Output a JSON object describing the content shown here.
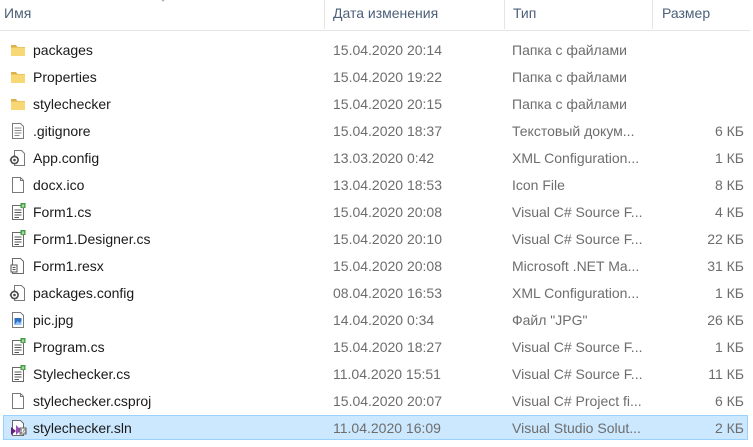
{
  "columns": {
    "name": "Имя",
    "date": "Дата изменения",
    "type": "Тип",
    "size": "Размер"
  },
  "files": [
    {
      "name": "packages",
      "date": "15.04.2020 20:14",
      "type": "Папка с файлами",
      "size": "",
      "icon": "folder-icon"
    },
    {
      "name": "Properties",
      "date": "15.04.2020 19:22",
      "type": "Папка с файлами",
      "size": "",
      "icon": "folder-icon"
    },
    {
      "name": "stylechecker",
      "date": "15.04.2020 20:15",
      "type": "Папка с файлами",
      "size": "",
      "icon": "folder-icon"
    },
    {
      "name": ".gitignore",
      "date": "15.04.2020 18:37",
      "type": "Текстовый докум...",
      "size": "6 КБ",
      "icon": "text-file-icon"
    },
    {
      "name": "App.config",
      "date": "13.03.2020 0:42",
      "type": "XML Configuration...",
      "size": "1 КБ",
      "icon": "config-file-icon"
    },
    {
      "name": "docx.ico",
      "date": "13.04.2020 18:53",
      "type": "Icon File",
      "size": "8 КБ",
      "icon": "blank-file-icon"
    },
    {
      "name": "Form1.cs",
      "date": "15.04.2020 20:08",
      "type": "Visual C# Source F...",
      "size": "4 КБ",
      "icon": "csharp-file-icon"
    },
    {
      "name": "Form1.Designer.cs",
      "date": "15.04.2020 20:10",
      "type": "Visual C# Source F...",
      "size": "22 КБ",
      "icon": "csharp-file-icon"
    },
    {
      "name": "Form1.resx",
      "date": "15.04.2020 20:08",
      "type": "Microsoft .NET Ma...",
      "size": "31 КБ",
      "icon": "resx-file-icon"
    },
    {
      "name": "packages.config",
      "date": "08.04.2020 16:53",
      "type": "XML Configuration...",
      "size": "1 КБ",
      "icon": "config-file-icon"
    },
    {
      "name": "pic.jpg",
      "date": "14.04.2020 0:34",
      "type": "Файл \"JPG\"",
      "size": "26 КБ",
      "icon": "image-file-icon"
    },
    {
      "name": "Program.cs",
      "date": "15.04.2020 18:27",
      "type": "Visual C# Source F...",
      "size": "1 КБ",
      "icon": "csharp-file-icon"
    },
    {
      "name": "Stylechecker.cs",
      "date": "11.04.2020 15:51",
      "type": "Visual C# Source F...",
      "size": "11 КБ",
      "icon": "csharp-file-icon"
    },
    {
      "name": "stylechecker.csproj",
      "date": "15.04.2020 20:07",
      "type": "Visual C# Project fi...",
      "size": "6 КБ",
      "icon": "blank-file-icon"
    },
    {
      "name": "stylechecker.sln",
      "date": "11.04.2020 16:09",
      "type": "Visual Studio Solut...",
      "size": "2 КБ",
      "icon": "solution-file-icon",
      "selected": true
    }
  ],
  "colors": {
    "selection_bg": "#cce8ff",
    "selection_border": "#99d1ff",
    "folder": "#f8d775",
    "header_text": "#4c607a"
  }
}
